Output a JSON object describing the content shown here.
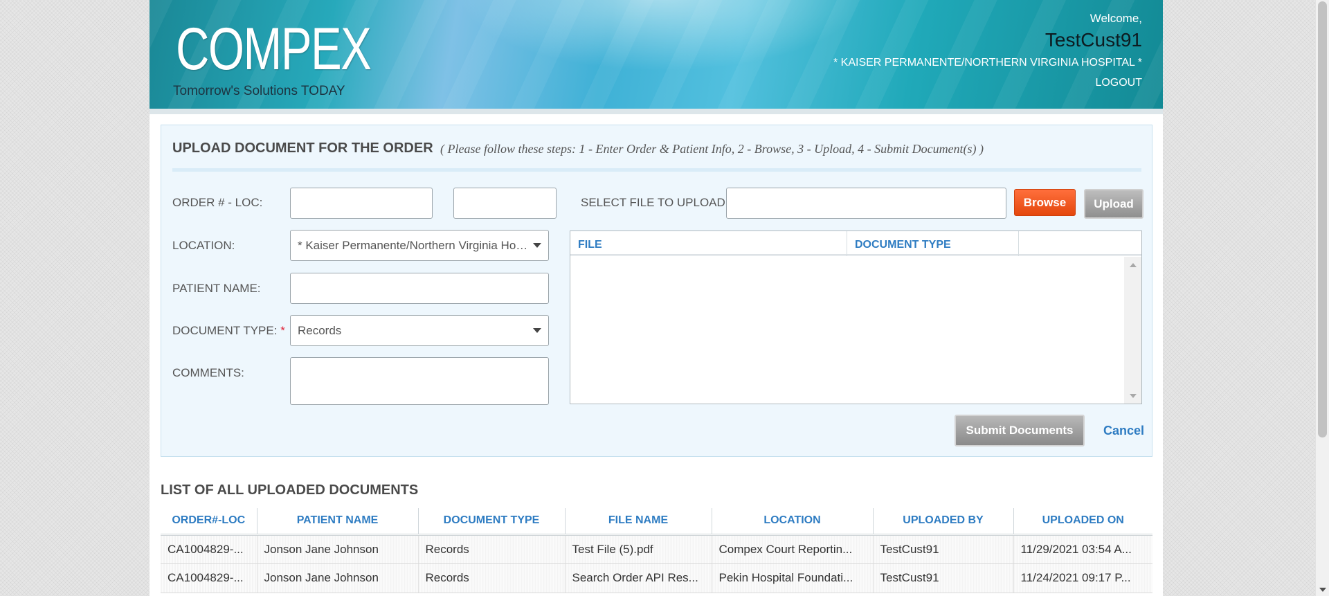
{
  "header": {
    "logo_text": "COMPEX",
    "tagline": "Tomorrow's Solutions TODAY",
    "welcome": "Welcome,",
    "username": "TestCust91",
    "location": "* KAISER PERMANENTE/NORTHERN VIRGINIA HOSPITAL *",
    "logout": "LOGOUT"
  },
  "upload": {
    "title": "UPLOAD DOCUMENT FOR THE ORDER",
    "hint": "( Please follow these steps: 1 - Enter Order & Patient Info, 2 - Browse, 3 - Upload, 4 - Submit Document(s) )",
    "labels": {
      "order": "ORDER # - LOC:",
      "location": "LOCATION:",
      "patient": "PATIENT NAME:",
      "doc_type": "DOCUMENT TYPE:",
      "required_mark": "*",
      "comments": "COMMENTS:",
      "select_file": "SELECT FILE TO UPLOAD:"
    },
    "values": {
      "order_number": "",
      "loc": "",
      "location": "* Kaiser Permanente/Northern Virginia Hospital *",
      "patient_name": "",
      "doc_type": "Records",
      "comments": "",
      "file": ""
    },
    "buttons": {
      "browse": "Browse",
      "upload": "Upload",
      "submit": "Submit Documents",
      "cancel": "Cancel"
    },
    "file_grid_columns": [
      "FILE",
      "DOCUMENT TYPE"
    ]
  },
  "list": {
    "title": "LIST OF ALL UPLOADED DOCUMENTS",
    "columns": [
      "ORDER#-LOC",
      "PATIENT NAME",
      "DOCUMENT TYPE",
      "FILE NAME",
      "LOCATION",
      "UPLOADED BY",
      "UPLOADED ON"
    ],
    "rows": [
      [
        "CA1004829-...",
        "Jonson Jane Johnson",
        "Records",
        "Test File (5).pdf",
        "Compex Court Reportin...",
        "TestCust91",
        "11/29/2021 03:54 A..."
      ],
      [
        "CA1004829-...",
        "Jonson Jane Johnson",
        "Records",
        "Search Order API Res...",
        "Pekin Hospital Foundati...",
        "TestCust91",
        "11/24/2021 09:17 P..."
      ]
    ]
  }
}
